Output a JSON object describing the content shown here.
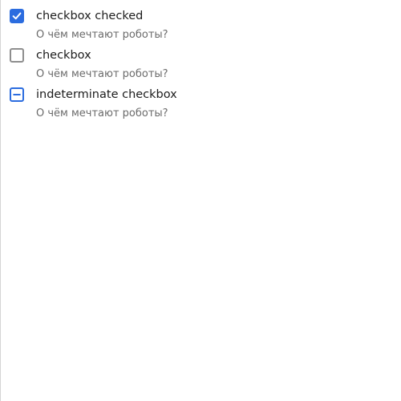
{
  "checkboxes": [
    {
      "label": "checkbox checked",
      "description": "О чём мечтают роботы?",
      "state": "checked"
    },
    {
      "label": "checkbox",
      "description": "О чём мечтают роботы?",
      "state": "unchecked"
    },
    {
      "label": "indeterminate checkbox",
      "description": "О чём мечтают роботы?",
      "state": "indeterminate"
    }
  ],
  "colors": {
    "accent": "#2b6cdf",
    "unchecked_border": "#8e8e8e",
    "label_text": "#1c1c1c",
    "description_text": "#6b6b6b"
  }
}
